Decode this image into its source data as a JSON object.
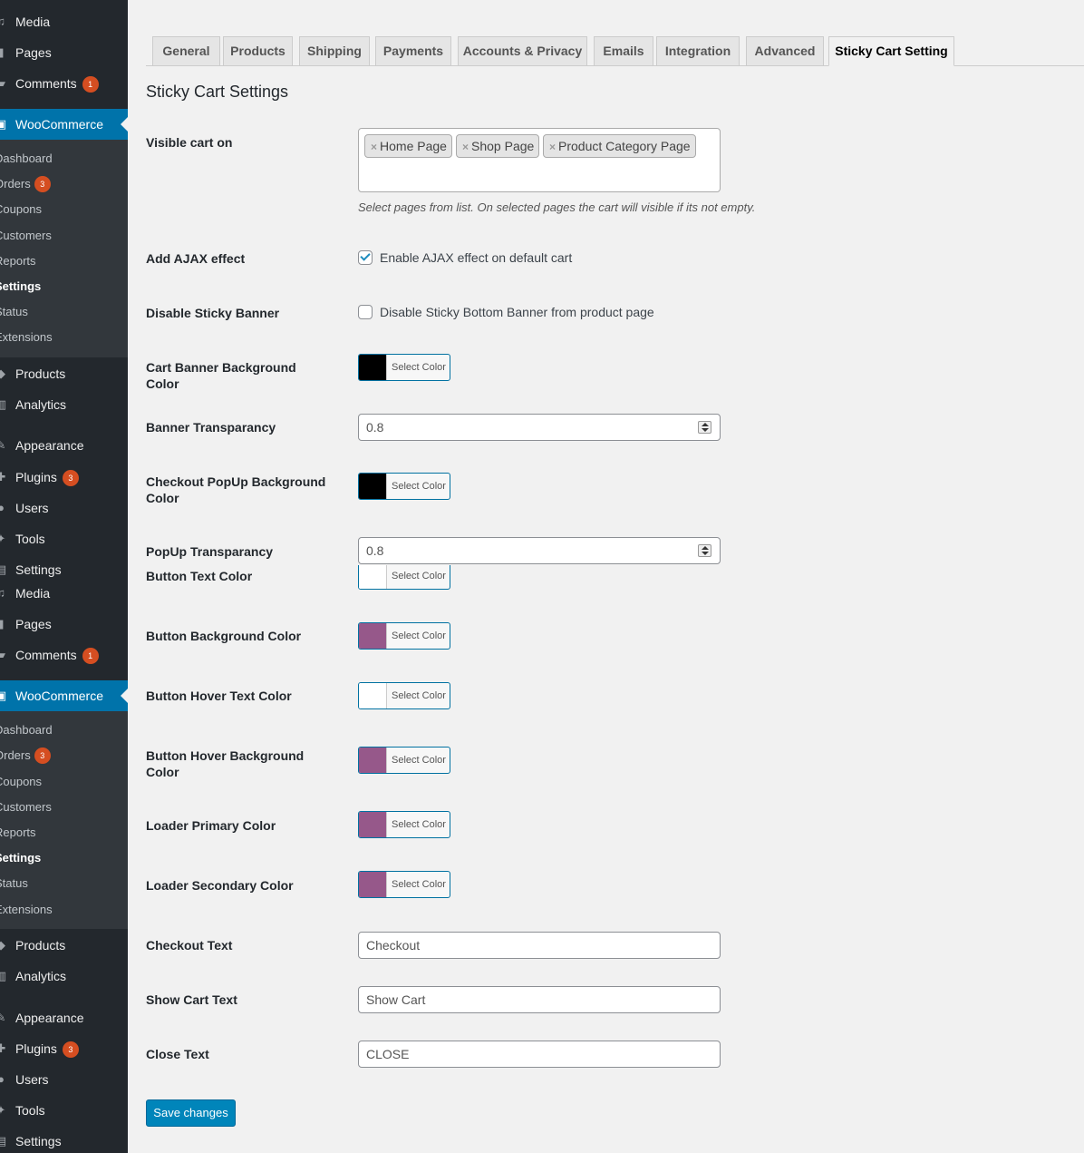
{
  "sidebar_top": [
    {
      "label": "Media",
      "icon": "media-icon"
    },
    {
      "label": "Pages",
      "icon": "pages-icon"
    },
    {
      "label": "Comments",
      "icon": "comments-icon",
      "badge": "1"
    }
  ],
  "woocommerce": {
    "label": "WooCommerce",
    "icon": "woocommerce-icon",
    "submenu": [
      {
        "label": "Dashboard"
      },
      {
        "label": "Orders",
        "badge": "3"
      },
      {
        "label": "Coupons"
      },
      {
        "label": "Customers"
      },
      {
        "label": "Reports"
      },
      {
        "label": "Settings",
        "current": true
      },
      {
        "label": "Status"
      },
      {
        "label": "Extensions"
      }
    ]
  },
  "sidebar_bottom": [
    {
      "label": "Products",
      "icon": "products-icon"
    },
    {
      "label": "Analytics",
      "icon": "analytics-icon"
    },
    {
      "label": "Appearance",
      "icon": "appearance-icon"
    },
    {
      "label": "Plugins",
      "icon": "plugins-icon",
      "badge": "3"
    },
    {
      "label": "Users",
      "icon": "users-icon"
    },
    {
      "label": "Tools",
      "icon": "tools-icon"
    },
    {
      "label": "Settings",
      "icon": "settings-icon"
    }
  ],
  "tabs": [
    {
      "label": "General"
    },
    {
      "label": "Products"
    },
    {
      "label": "Shipping"
    },
    {
      "label": "Payments"
    },
    {
      "label": "Accounts & Privacy"
    },
    {
      "label": "Emails"
    },
    {
      "label": "Integration"
    },
    {
      "label": "Advanced"
    },
    {
      "label": "Sticky Cart Setting",
      "active": true
    }
  ],
  "page_title": "Sticky Cart Settings",
  "visible_cart": {
    "label": "Visible cart on",
    "selected": [
      "Home Page",
      "Shop Page",
      "Product Category Page"
    ],
    "remove_symbol": "×",
    "description": "Select pages from list. On selected pages the cart will visible if its not empty."
  },
  "ajax_effect": {
    "label": "Add AJAX effect",
    "checkbox_label": "Enable AJAX effect on default cart",
    "checked": true
  },
  "disable_banner": {
    "label": "Disable Sticky Banner",
    "checkbox_label": "Disable Sticky Bottom Banner from product page",
    "checked": false
  },
  "select_color_text": "Select Color",
  "cart_banner_bg": {
    "label": "Cart Banner Background Color",
    "color": "#000000"
  },
  "banner_transparency": {
    "label": "Banner Transparancy",
    "value": "0.8"
  },
  "checkout_popup_bg": {
    "label": "Checkout PopUp Background Color",
    "color": "#000000"
  },
  "popup_transparency": {
    "label": "PopUp Transparancy",
    "value": "0.8"
  },
  "button_text_color": {
    "label": "Button Text Color",
    "color": "#ffffff"
  },
  "button_bg_color": {
    "label": "Button Background Color",
    "color": "#96588a"
  },
  "button_hover_text_color": {
    "label": "Button Hover Text Color",
    "color": "#ffffff"
  },
  "button_hover_bg_color": {
    "label": "Button Hover Background Color",
    "color": "#96588a"
  },
  "loader_primary_color": {
    "label": "Loader Primary Color",
    "color": "#96588a"
  },
  "loader_secondary_color": {
    "label": "Loader Secondary Color",
    "color": "#96588a"
  },
  "checkout_text": {
    "label": "Checkout Text",
    "value": "Checkout"
  },
  "show_cart_text": {
    "label": "Show Cart Text",
    "value": "Show Cart"
  },
  "close_text": {
    "label": "Close Text",
    "value": "CLOSE"
  },
  "save_button": "Save changes",
  "colors": {
    "sidebar_bg": "#23282d",
    "submenu_bg": "#32373c",
    "accent": "#0073aa",
    "badge": "#d54e21",
    "button_primary": "#0085ba"
  }
}
